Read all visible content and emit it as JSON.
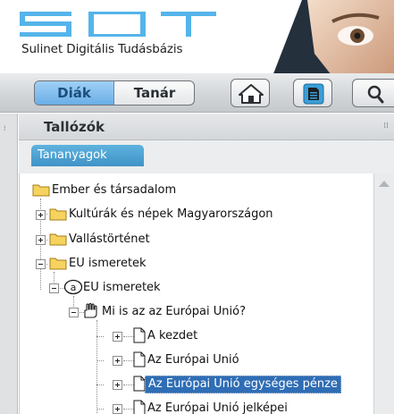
{
  "header": {
    "logo_text": "SDT",
    "tagline": "Sulinet Digitális Tudásbázis"
  },
  "toolbar": {
    "tabs": [
      {
        "label": "Diák",
        "active": true
      },
      {
        "label": "Tanár",
        "active": false
      }
    ],
    "buttons": [
      {
        "icon": "home-icon"
      },
      {
        "icon": "document-icon"
      },
      {
        "icon": "search-icon"
      }
    ]
  },
  "panel": {
    "title": "Tallózók",
    "subtab": "Tananyagok"
  },
  "tree": {
    "items": [
      {
        "label": "Ember és társadalom",
        "icon": "folder-icon",
        "expanded": true
      },
      {
        "label": "Kultúrák és népek Magyarországon",
        "icon": "folder-icon",
        "expanded": false
      },
      {
        "label": "Vallástörténet",
        "icon": "folder-icon",
        "expanded": false
      },
      {
        "label": "EU ismeretek",
        "icon": "folder-icon",
        "expanded": true
      },
      {
        "label": "EU ismeretek",
        "icon": "module-icon",
        "expanded": true
      },
      {
        "label": "Mi is az az Európai Unió?",
        "icon": "lesson-hand-icon",
        "expanded": true
      },
      {
        "label": "A kezdet",
        "icon": "page-icon",
        "expanded": false
      },
      {
        "label": "Az Európai Unió",
        "icon": "page-icon",
        "expanded": false
      },
      {
        "label": "Az Európai Unió egységes pénze",
        "icon": "page-icon",
        "expanded": false,
        "selected": true
      },
      {
        "label": "Az Európai Unió jelképei",
        "icon": "page-icon",
        "expanded": false
      }
    ]
  },
  "colors": {
    "accent_blue": "#5fb2de",
    "selection": "#2f6db5",
    "folder": "#f2c94c"
  }
}
